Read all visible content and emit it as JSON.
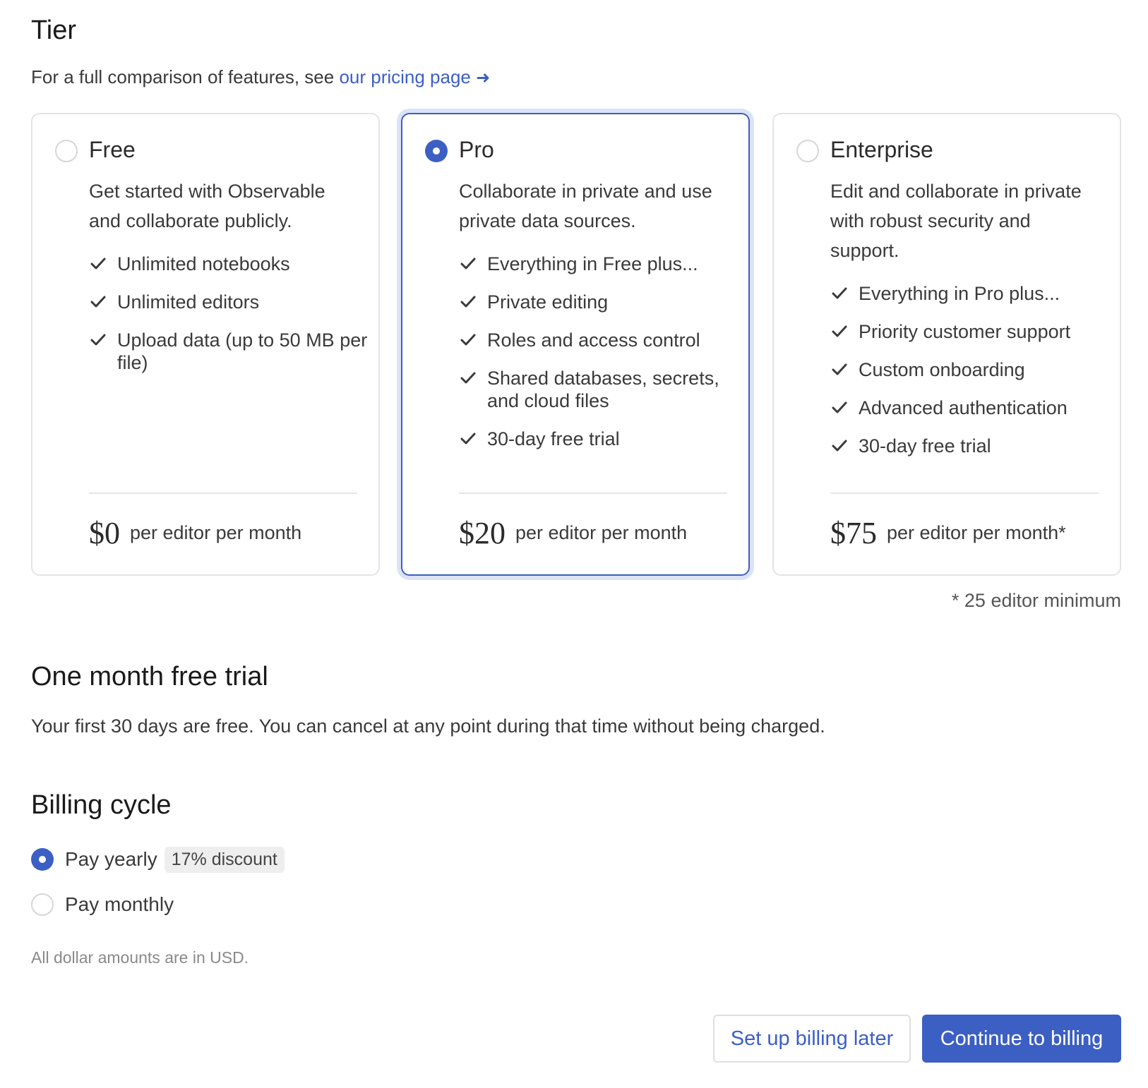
{
  "header": {
    "title": "Tier",
    "subtitle_prefix": "For a full comparison of features, see ",
    "pricing_link": "our pricing page",
    "pricing_link_arrow": "➜"
  },
  "tiers": [
    {
      "name": "Free",
      "selected": false,
      "description": "Get started with Observable and collaborate publicly.",
      "features": [
        "Unlimited notebooks",
        "Unlimited editors",
        "Upload data (up to 50 MB per file)"
      ],
      "price": "$0",
      "unit": "per editor per month"
    },
    {
      "name": "Pro",
      "selected": true,
      "description": "Collaborate in private and use private data sources.",
      "features": [
        "Everything in Free plus...",
        "Private editing",
        "Roles and access control",
        "Shared databases, secrets, and cloud files",
        "30-day free trial"
      ],
      "price": "$20",
      "unit": "per editor per month"
    },
    {
      "name": "Enterprise",
      "selected": false,
      "description": "Edit and collaborate in private with robust security and support.",
      "features": [
        "Everything in Pro plus...",
        "Priority customer support",
        "Custom onboarding",
        "Advanced authentication",
        "30-day free trial"
      ],
      "price": "$75",
      "unit": "per editor per month*"
    }
  ],
  "footnote": "* 25 editor minimum",
  "trial": {
    "title": "One month free trial",
    "text": "Your first 30 days are free. You can cancel at any point during that time without being charged."
  },
  "billing": {
    "title": "Billing cycle",
    "yearly_label": "Pay yearly",
    "yearly_badge": "17% discount",
    "monthly_label": "Pay monthly",
    "selected": "yearly"
  },
  "note": "All dollar amounts are in USD.",
  "buttons": {
    "later": "Set up billing later",
    "continue": "Continue to billing"
  },
  "colors": {
    "accent": "#3c5fc4",
    "accent_ring": "#dbe3f8",
    "border": "#e4e4e4"
  },
  "icons": {
    "check": "check-icon",
    "radio_selected": "radio-selected-icon",
    "radio_unselected": "radio-unselected-icon"
  }
}
